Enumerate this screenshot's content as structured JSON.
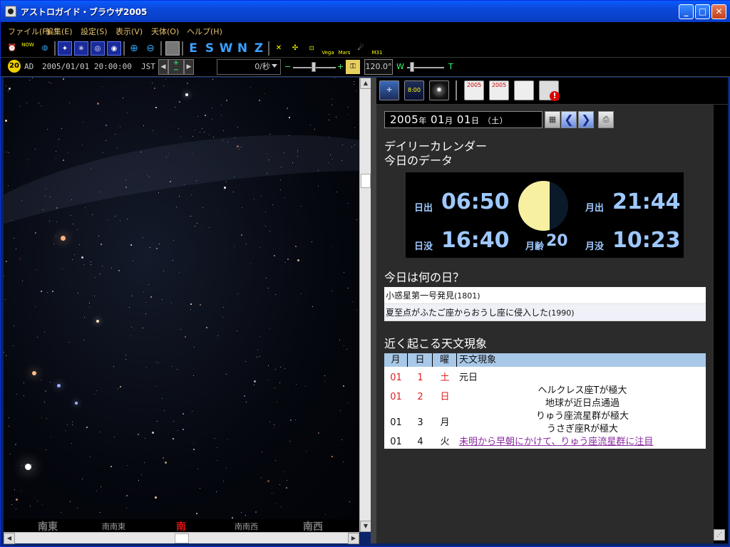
{
  "window": {
    "title": "アストロガイド・ブラウザ2005"
  },
  "menu": {
    "items": [
      "ファイル(F)",
      "編集(E)",
      "設定(S)",
      "表示(V)",
      "天体(O)",
      "ヘルプ(H)"
    ]
  },
  "toolbar": {
    "directions": [
      "E",
      "S",
      "W",
      "N",
      "Z"
    ],
    "now_label": "NOW",
    "vega_label": "Vega",
    "mars_label": "Mars",
    "m31_label": "M31"
  },
  "timebar": {
    "era_badge": "20",
    "era": "AD",
    "datetime": "2005/01/01 20:00:00",
    "timezone": "JST",
    "speed": "0/秒",
    "fov": "120.0°",
    "w_label": "W",
    "t_label": "T"
  },
  "compass": {
    "se": "南東",
    "sse": "南南東",
    "s": "南",
    "ssw": "南南西",
    "sw": "南西"
  },
  "panel": {
    "tools": [
      "2005",
      "2005"
    ],
    "date": {
      "year": "2005",
      "y_unit": "年",
      "month": "01",
      "m_unit": "月",
      "day": "01",
      "d_unit": "日",
      "weekday": "（土）"
    },
    "calendar_title": "デイリーカレンダー",
    "today_data_title": "今日のデータ",
    "sun_moon": {
      "sunrise_label": "日出",
      "sunrise": "06:50",
      "sunset_label": "日没",
      "sunset": "16:40",
      "moonrise_label": "月出",
      "moonrise": "21:44",
      "moonset_label": "月没",
      "moonset": "10:23",
      "moon_age_label": "月齢",
      "moon_age": "20"
    },
    "whatday_title": "今日は何の日？",
    "anniversaries": [
      {
        "text": "小惑星第一号発見",
        "year": "(1801)"
      },
      {
        "text": "夏至点がふたご座からおうし座に侵入した",
        "year": "(1990)"
      }
    ],
    "events_title": "近く起こる天文現象",
    "events_header": {
      "month": "月",
      "day": "日",
      "weekday": "曜",
      "event": "天文現象"
    },
    "events": [
      {
        "month": "01",
        "day": "1",
        "weekday": "土",
        "text": "元日"
      },
      {
        "month": "01",
        "day": "2",
        "weekday": "日",
        "text": "ヘルクレス座Tが極大"
      },
      {
        "text": "地球が近日点通過"
      },
      {
        "month": "01",
        "day": "3",
        "weekday": "月",
        "text": "りゅう座流星群が極大"
      },
      {
        "text": "うさぎ座Rが極大"
      },
      {
        "month": "01",
        "day": "4",
        "weekday": "火",
        "text": "未明から早朝にかけて、りゅう座流星群に注目"
      }
    ]
  }
}
